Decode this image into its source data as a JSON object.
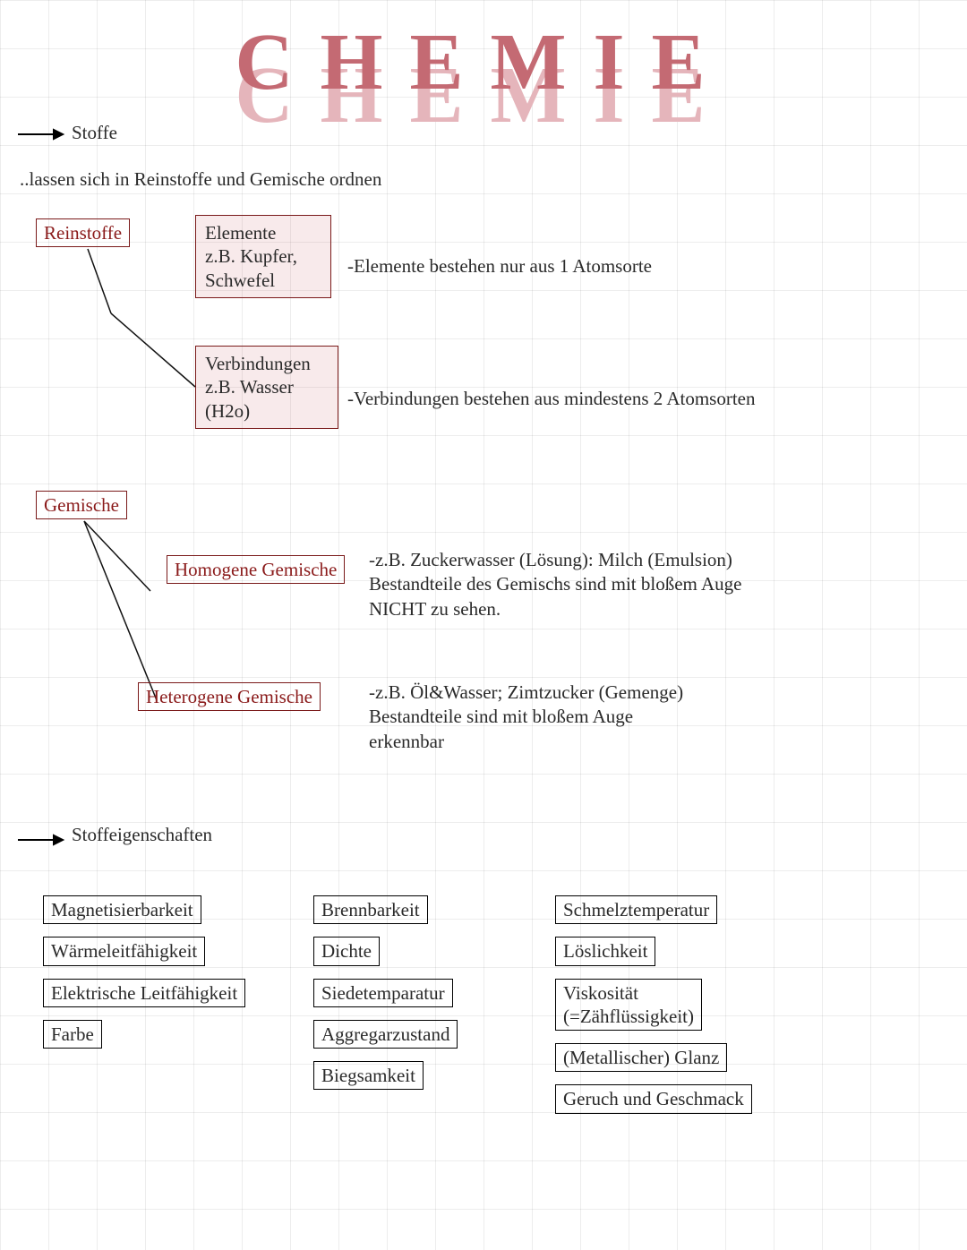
{
  "title": "CHEMIE",
  "section1": {
    "heading": "Stoffe",
    "intro": "..lassen sich in Reinstoffe und Gemische ordnen",
    "reinstoffe": {
      "label": "Reinstoffe",
      "elemente": {
        "box": "Elemente\nz.B. Kupfer,\nSchwefel",
        "note": "-Elemente bestehen nur aus 1 Atomsorte"
      },
      "verbindungen": {
        "box": "Verbindungen\nz.B. Wasser\n(H2o)",
        "note": "-Verbindungen bestehen aus mindestens 2 Atomsorten"
      }
    },
    "gemische": {
      "label": "Gemische",
      "homogen": {
        "box": "Homogene Gemische",
        "note": "-z.B. Zuckerwasser (Lösung): Milch (Emulsion)\nBestandteile des Gemischs sind mit bloßem Auge\nNICHT zu sehen."
      },
      "heterogen": {
        "box": "Heterogene Gemische",
        "note": "-z.B. Öl&Wasser; Zimtzucker (Gemenge)\nBestandteile sind mit bloßem Auge\nerkennbar"
      }
    }
  },
  "section2": {
    "heading": "Stoffeigenschaften",
    "col1": [
      "Magnetisierbarkeit",
      "Wärmeleitfähigkeit",
      "Elektrische Leitfähigkeit",
      "Farbe"
    ],
    "col2": [
      "Brennbarkeit",
      "Dichte",
      "Siedetemparatur",
      "Aggregarzustand",
      "Biegsamkeit"
    ],
    "col3": [
      "Schmelztemperatur",
      "Löslichkeit",
      "Viskosität\n(=Zähflüssigkeit)",
      "(Metallischer) Glanz",
      "Geruch und Geschmack"
    ]
  }
}
